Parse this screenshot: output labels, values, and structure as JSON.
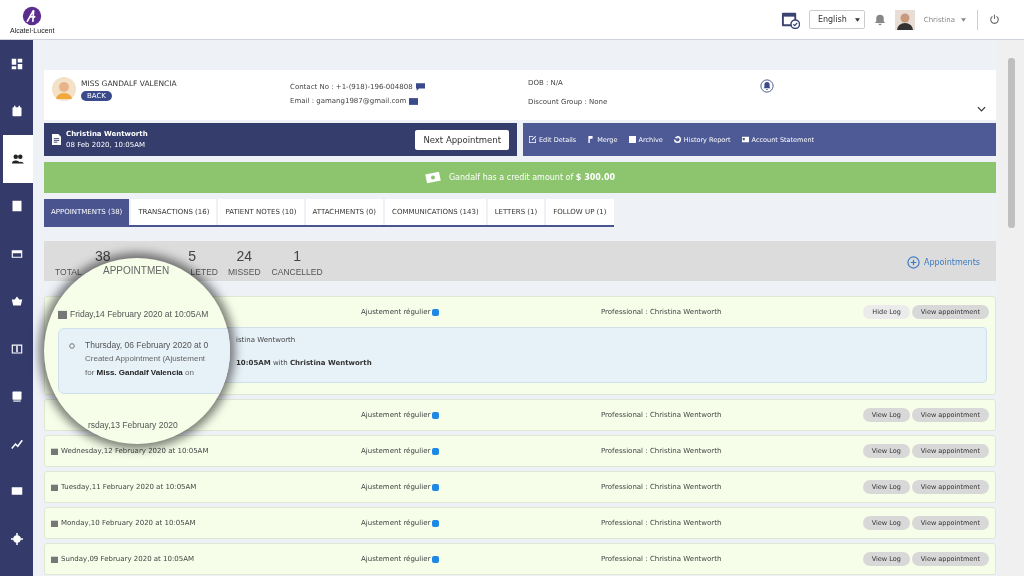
{
  "header": {
    "logo_text": "Alcatel·Lucent",
    "language": "English",
    "user": "Christina"
  },
  "sidebar": {
    "items": [
      {
        "selected": false
      },
      {
        "selected": false
      },
      {
        "selected": true
      },
      {
        "selected": false
      },
      {
        "selected": false
      },
      {
        "selected": false
      },
      {
        "selected": false
      },
      {
        "selected": false
      },
      {
        "selected": false
      },
      {
        "selected": false
      },
      {
        "selected": false
      }
    ]
  },
  "patient": {
    "name": "MISS GANDALF VALENCIA",
    "badge": "BACK",
    "contact": "Contact No : +1-(918)-196-004808",
    "email": "Email : gamang1987@gmail.com",
    "dob": "DOB : N/A",
    "discount_group": "Discount Group : None"
  },
  "next_appointment": {
    "professional": "Christina Wentworth",
    "date": "08 Feb 2020, 10:05AM",
    "button": "Next Appointment"
  },
  "actions": [
    {
      "label": "Edit Details"
    },
    {
      "label": "Merge"
    },
    {
      "label": "Archive"
    },
    {
      "label": "History Report"
    },
    {
      "label": "Account Statement"
    }
  ],
  "credit_banner": "Gandalf has a credit amount of **$ 300.00**",
  "tabs": [
    {
      "label": "APPOINTMENTS (38)",
      "selected": true
    },
    {
      "label": "TRANSACTIONS (16)",
      "selected": false
    },
    {
      "label": "PATIENT NOTES (10)",
      "selected": false
    },
    {
      "label": "ATTACHMENTS (0)",
      "selected": false
    },
    {
      "label": "COMMUNICATIONS (143)",
      "selected": false
    },
    {
      "label": "LETTERS (1)",
      "selected": false
    },
    {
      "label": "FOLLOW UP (1)",
      "selected": false
    }
  ],
  "stats": [
    {
      "value": "38",
      "label": "TOTAL"
    },
    {
      "value": "5",
      "label": "LETED"
    },
    {
      "value": "24",
      "label": "MISSED"
    },
    {
      "value": "1",
      "label": "CANCELLED"
    }
  ],
  "add_button": "Appointments",
  "appointments": [
    {
      "type": "Ajustement régulier",
      "color": "#1e88e5",
      "professional": "Professional : Christina Wentworth",
      "log_button": "Hide Log",
      "view_button": "View appointment",
      "expanded": true,
      "log_lines": [
        "istina Wentworth",
        "**10:05AM** with **Christina Wentworth**"
      ]
    },
    {
      "type": "Ajustement régulier",
      "color": "#1e88e5",
      "professional": "Professional : Christina Wentworth",
      "log_button": "View Log",
      "view_button": "View appointment",
      "expanded": false
    },
    {
      "date": "Wednesday,12 February 2020 at 10:05AM",
      "type": "Ajustement régulier",
      "color": "#1e88e5",
      "professional": "Professional : Christina Wentworth",
      "log_button": "View Log",
      "view_button": "View appointment",
      "expanded": false
    },
    {
      "date": "Tuesday,11 February 2020 at 10:05AM",
      "type": "Ajustement régulier",
      "color": "#1e88e5",
      "professional": "Professional : Christina Wentworth",
      "log_button": "View Log",
      "view_button": "View appointment",
      "expanded": false
    },
    {
      "date": "Monday,10 February 2020 at 10:05AM",
      "type": "Ajustement régulier",
      "color": "#1e88e5",
      "professional": "Professional : Christina Wentworth",
      "log_button": "View Log",
      "view_button": "View appointment",
      "expanded": false
    },
    {
      "date": "Sunday,09 February 2020 at 10:05AM",
      "type": "Ajustement régulier",
      "color": "#1e88e5",
      "professional": "Professional : Christina Wentworth",
      "log_button": "View Log",
      "view_button": "View appointment",
      "expanded": false
    }
  ],
  "magnifier": {
    "heading": "APPOINTMEN",
    "date": "Friday,14 February 2020 at 10:05AM",
    "log_lines": [
      "Thursday, 06 February 2020 at 0",
      "Created Appointment (Ajustement",
      "for **Miss. Gandalf Valencia** on"
    ],
    "next_date": "rsday,13 February 2020"
  }
}
